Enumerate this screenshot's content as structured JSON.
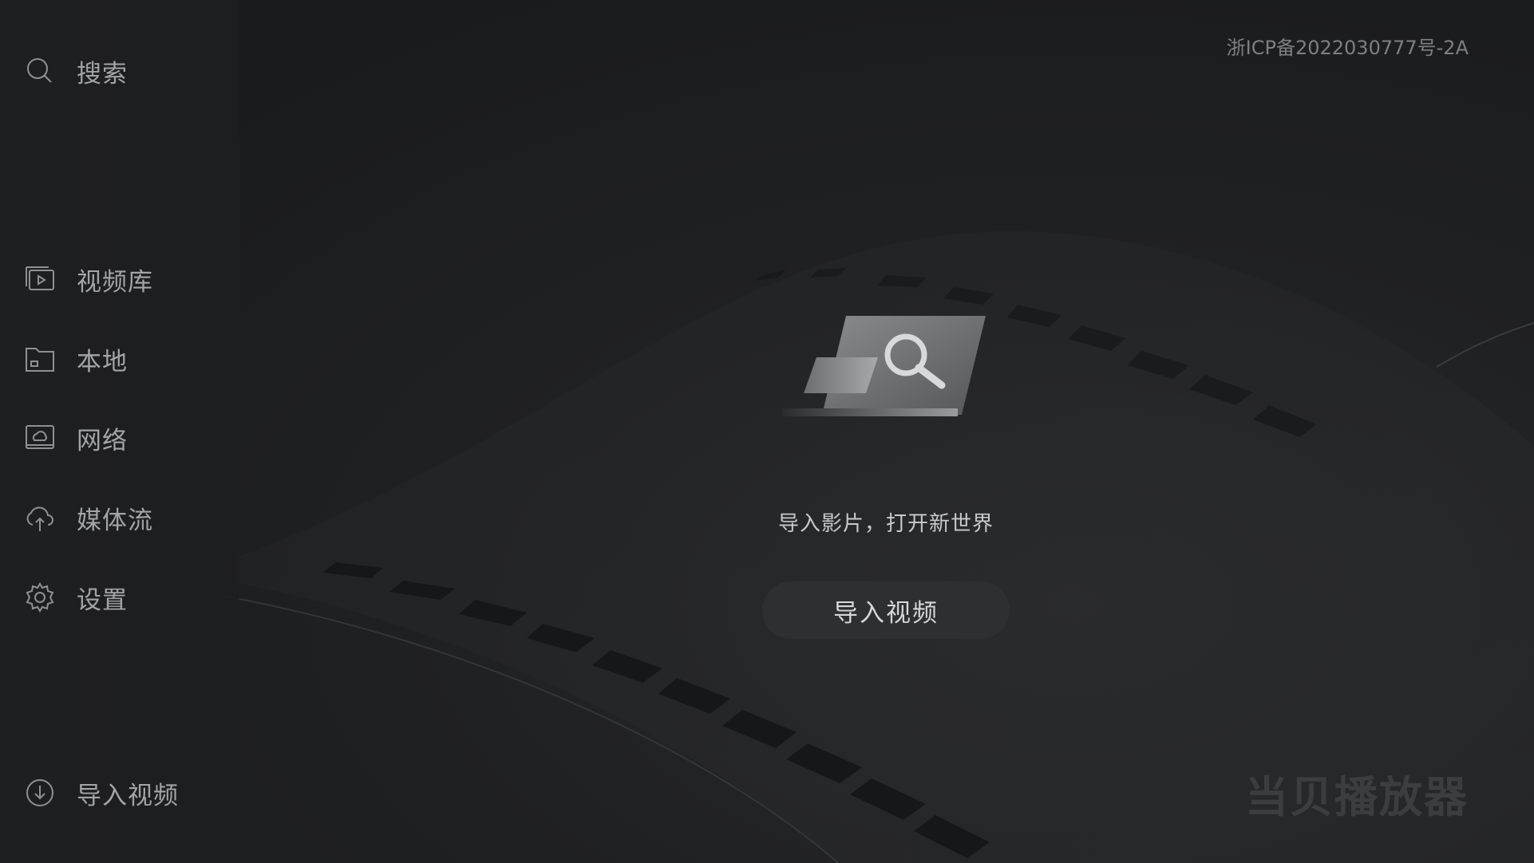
{
  "sidebar": {
    "items": [
      {
        "label": "搜索",
        "icon": "search-icon"
      },
      {
        "label": "视频库",
        "icon": "video-library-icon"
      },
      {
        "label": "本地",
        "icon": "folder-icon"
      },
      {
        "label": "网络",
        "icon": "network-icon"
      },
      {
        "label": "媒体流",
        "icon": "cloud-upload-icon"
      },
      {
        "label": "设置",
        "icon": "gear-icon"
      },
      {
        "label": "导入视频",
        "icon": "download-circle-icon"
      }
    ]
  },
  "header": {
    "icp": "浙ICP备2022030777号-2A"
  },
  "main": {
    "empty_message": "导入影片，打开新世界",
    "import_button_label": "导入视频",
    "illustration_icon": "magnifier-card-icon"
  },
  "brand": {
    "watermark": "当贝播放器"
  },
  "colors": {
    "background": "#1b1c20",
    "sidebar": "#1e1f23",
    "text_primary": "#c9cacd",
    "text_secondary": "#a3a4a8",
    "button_bg": "#2e2f33"
  }
}
